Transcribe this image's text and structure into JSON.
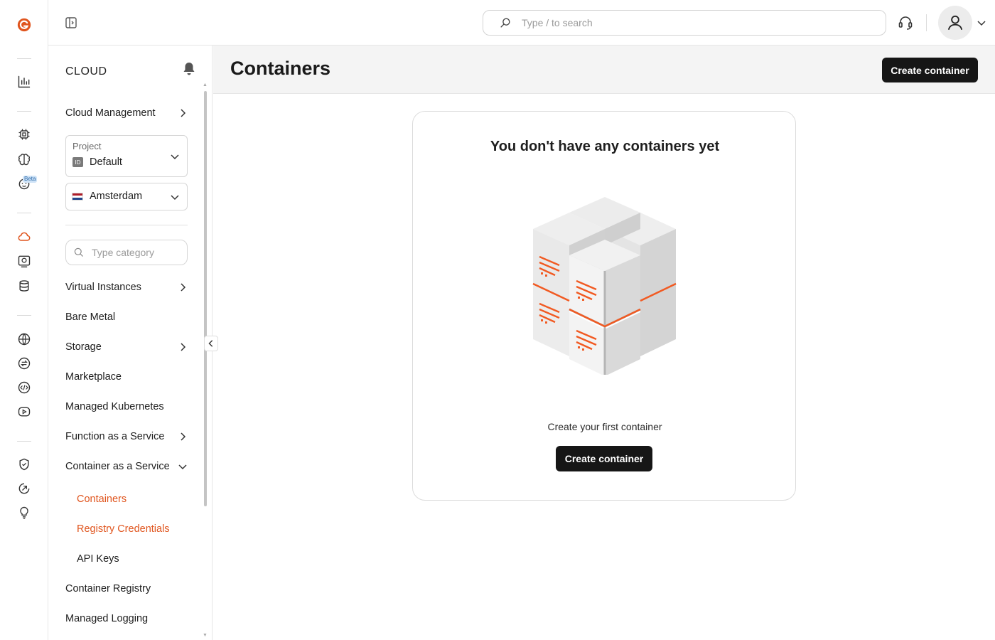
{
  "header": {
    "search_placeholder": "Type / to search"
  },
  "rail": {
    "beta_label": "Beta"
  },
  "sidebar": {
    "title": "CLOUD",
    "cloud_management": "Cloud Management",
    "project_label": "Project",
    "project_id_badge": "ID",
    "project_value": "Default",
    "region_value": "Amsterdam",
    "category_placeholder": "Type category",
    "items": [
      {
        "label": "Virtual Instances",
        "has_chevron": true
      },
      {
        "label": "Bare Metal",
        "has_chevron": false
      },
      {
        "label": "Storage",
        "has_chevron": true
      },
      {
        "label": "Marketplace",
        "has_chevron": false
      },
      {
        "label": "Managed Kubernetes",
        "has_chevron": false
      },
      {
        "label": "Function as a Service",
        "has_chevron": true
      },
      {
        "label": "Container as a Service",
        "has_chevron": true,
        "expanded": true
      },
      {
        "label": "Containers",
        "sub": true,
        "active": true
      },
      {
        "label": "Registry Credentials",
        "sub": true,
        "active": true
      },
      {
        "label": "API Keys",
        "sub": true
      },
      {
        "label": "Container Registry",
        "has_chevron": false
      },
      {
        "label": "Managed Logging",
        "has_chevron": false
      }
    ]
  },
  "main": {
    "title": "Containers",
    "create_button": "Create container",
    "empty": {
      "title": "You don't have any containers yet",
      "subtitle": "Create your first container",
      "button": "Create container"
    }
  },
  "colors": {
    "accent": "#e0551e",
    "dark_button": "#161616"
  }
}
